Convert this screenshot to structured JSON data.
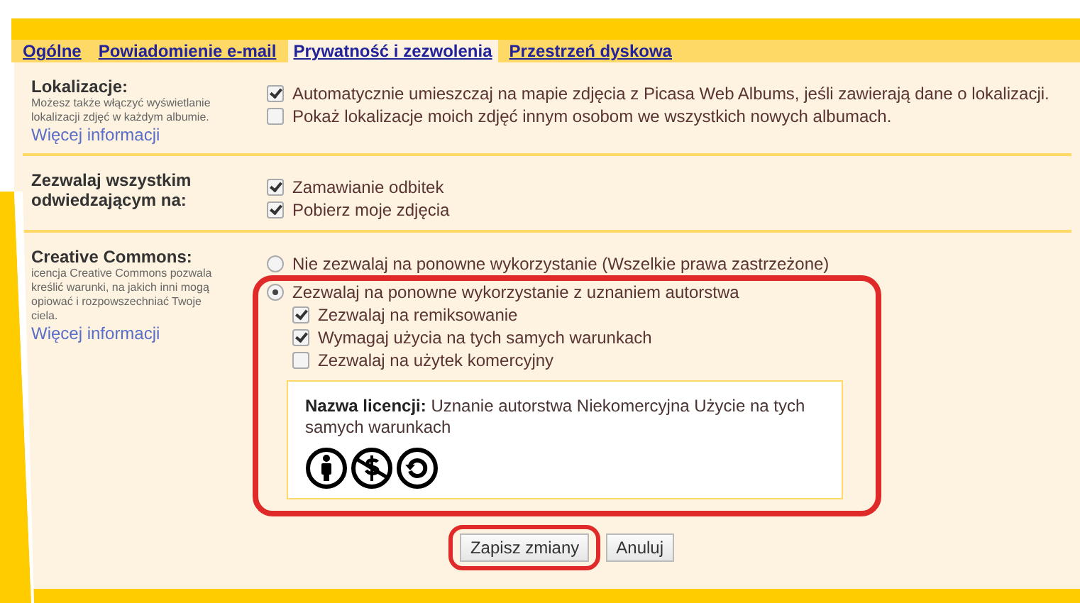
{
  "tabs": [
    {
      "label": "Ogólne",
      "selected": false
    },
    {
      "label": "Powiadomienie e-mail",
      "selected": false
    },
    {
      "label": "Prywatność i zezwolenia",
      "selected": true
    },
    {
      "label": "Przestrzeń dyskowa",
      "selected": false
    }
  ],
  "sections": [
    {
      "title": "Lokalizacje:",
      "description_lines": [
        "Możesz także włączyć wyświetlanie",
        "lokalizacji zdjęć w każdym albumie."
      ],
      "link": "Więcej informacji",
      "options": [
        {
          "kind": "checkbox",
          "label": "Automatycznie umieszczaj na mapie zdjęcia z Picasa Web Albums, jeśli zawierają dane o lokalizacji.",
          "checked": true
        },
        {
          "kind": "checkbox",
          "label": "Pokaż lokalizacje moich zdjęć innym osobom we wszystkich nowych albumach.",
          "checked": false
        }
      ]
    },
    {
      "title": "Zezwalaj wszystkim odwiedzającym na:",
      "options": [
        {
          "kind": "checkbox",
          "label": "Zamawianie odbitek",
          "checked": true
        },
        {
          "kind": "checkbox",
          "label": "Pobierz moje zdjęcia",
          "checked": true
        }
      ]
    },
    {
      "title": "Creative Commons:",
      "description_lines": [
        "icencja Creative Commons pozwala",
        "kreślić warunki, na jakich inni mogą",
        "opiować i rozpowszechniać Twoje",
        "ciela."
      ],
      "link": "Więcej informacji",
      "options": [
        {
          "kind": "radio",
          "label": "Nie zezwalaj na ponowne wykorzystanie (Wszelkie prawa zastrzeżone)",
          "selected": false,
          "highlighted": false
        },
        {
          "kind": "radio",
          "label": "Zezwalaj na ponowne wykorzystanie z uznaniem autorstwa",
          "selected": true,
          "highlighted": true,
          "children": [
            {
              "label": "Zezwalaj na remiksowanie",
              "checked": true
            },
            {
              "label": "Wymagaj użycia na tych samych warunkach",
              "checked": true
            },
            {
              "label": "Zezwalaj na użytek komercyjny",
              "checked": false
            }
          ],
          "license": {
            "name_label": "Nazwa licencji:",
            "name": "Uznanie autorstwa Niekomercyjna Użycie na tych samych warunkach"
          }
        }
      ]
    }
  ],
  "buttons": [
    {
      "label": "Zapisz zmiany",
      "highlighted": true
    },
    {
      "label": "Anuluj",
      "highlighted": false
    }
  ]
}
